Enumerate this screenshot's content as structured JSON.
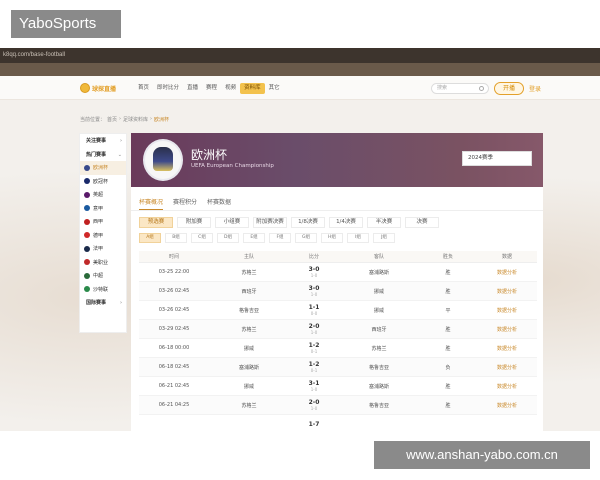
{
  "watermarks": {
    "top": "YaboSports",
    "bottom": "www.anshan-yabo.com.cn"
  },
  "browser": {
    "url": "k8qq.com/base-football"
  },
  "header": {
    "logo_text": "球探直播",
    "nav": [
      {
        "label": "首页",
        "active": false
      },
      {
        "label": "即时比分",
        "active": false
      },
      {
        "label": "直播",
        "active": false
      },
      {
        "label": "赛程",
        "active": false
      },
      {
        "label": "视频",
        "active": false
      },
      {
        "label": "资料库",
        "active": true
      },
      {
        "label": "其它",
        "active": false
      }
    ],
    "search_placeholder": "搜索",
    "open_button": "开播",
    "login": "登录"
  },
  "breadcrumb": {
    "prefix": "当前位置：",
    "items": [
      "首页",
      "足球资料库",
      "欧洲杯"
    ]
  },
  "sidebar": {
    "follow_label": "关注赛事",
    "hot_label": "热门赛事",
    "leagues": [
      {
        "label": "欧洲杯",
        "active": true,
        "color": "#3a4a8a"
      },
      {
        "label": "欧冠杯",
        "active": false,
        "color": "#1a2a6a"
      },
      {
        "label": "英超",
        "active": false,
        "color": "#5a1a6a"
      },
      {
        "label": "意甲",
        "active": false,
        "color": "#1a5aa0"
      },
      {
        "label": "西甲",
        "active": false,
        "color": "#c02020"
      },
      {
        "label": "德甲",
        "active": false,
        "color": "#d02828"
      },
      {
        "label": "法甲",
        "active": false,
        "color": "#1a2a4a"
      },
      {
        "label": "美职业",
        "active": false,
        "color": "#c02a2a"
      },
      {
        "label": "中超",
        "active": false,
        "color": "#2a6a3a"
      },
      {
        "label": "沙特联",
        "active": false,
        "color": "#2a8a4a"
      }
    ],
    "intl_label": "国际赛事"
  },
  "hero": {
    "title": "欧洲杯",
    "subtitle": "UEFA European Championship",
    "season": "2024赛季"
  },
  "tabs": [
    {
      "label": "杯赛概况",
      "active": true
    },
    {
      "label": "赛程积分",
      "active": false
    },
    {
      "label": "杯赛数据",
      "active": false
    }
  ],
  "stages": [
    {
      "label": "预选赛",
      "active": true
    },
    {
      "label": "附加赛",
      "active": false
    },
    {
      "label": "小组赛",
      "active": false
    },
    {
      "label": "附加赛决赛",
      "active": false
    },
    {
      "label": "1/8决赛",
      "active": false
    },
    {
      "label": "1/4决赛",
      "active": false
    },
    {
      "label": "半决赛",
      "active": false
    },
    {
      "label": "决赛",
      "active": false
    }
  ],
  "rounds": [
    {
      "label": "A组",
      "active": true
    },
    {
      "label": "B组",
      "active": false
    },
    {
      "label": "C组",
      "active": false
    },
    {
      "label": "D组",
      "active": false
    },
    {
      "label": "E组",
      "active": false
    },
    {
      "label": "F组",
      "active": false
    },
    {
      "label": "G组",
      "active": false
    },
    {
      "label": "H组",
      "active": false
    },
    {
      "label": "I组",
      "active": false
    },
    {
      "label": "J组",
      "active": false
    }
  ],
  "table": {
    "headers": [
      "时间",
      "主队",
      "比分",
      "客队",
      "胜负",
      "数据"
    ],
    "rows": [
      {
        "time": "03-25 22:00",
        "home": "苏格兰",
        "score": "3-0",
        "half": "1-0",
        "away": "塞浦路斯",
        "result": "胜",
        "data": "数据分析"
      },
      {
        "time": "03-26 02:45",
        "home": "西班牙",
        "score": "3-0",
        "half": "1-0",
        "away": "挪威",
        "result": "胜",
        "data": "数据分析"
      },
      {
        "time": "03-26 02:45",
        "home": "格鲁吉亚",
        "score": "1-1",
        "half": "0-0",
        "away": "挪威",
        "result": "平",
        "data": "数据分析"
      },
      {
        "time": "03-29 02:45",
        "home": "苏格兰",
        "score": "2-0",
        "half": "1-0",
        "away": "西班牙",
        "result": "胜",
        "data": "数据分析"
      },
      {
        "time": "06-18 00:00",
        "home": "挪威",
        "score": "1-2",
        "half": "0-1",
        "away": "苏格兰",
        "result": "胜",
        "data": "数据分析"
      },
      {
        "time": "06-18 02:45",
        "home": "塞浦路斯",
        "score": "1-2",
        "half": "0-1",
        "away": "格鲁吉亚",
        "result": "负",
        "data": "数据分析"
      },
      {
        "time": "06-21 02:45",
        "home": "挪威",
        "score": "3-1",
        "half": "1-0",
        "away": "塞浦路斯",
        "result": "胜",
        "data": "数据分析"
      },
      {
        "time": "06-21 04:25",
        "home": "苏格兰",
        "score": "2-0",
        "half": "1-0",
        "away": "格鲁吉亚",
        "result": "胜",
        "data": "数据分析"
      }
    ],
    "partial_row_score": "1-7"
  }
}
